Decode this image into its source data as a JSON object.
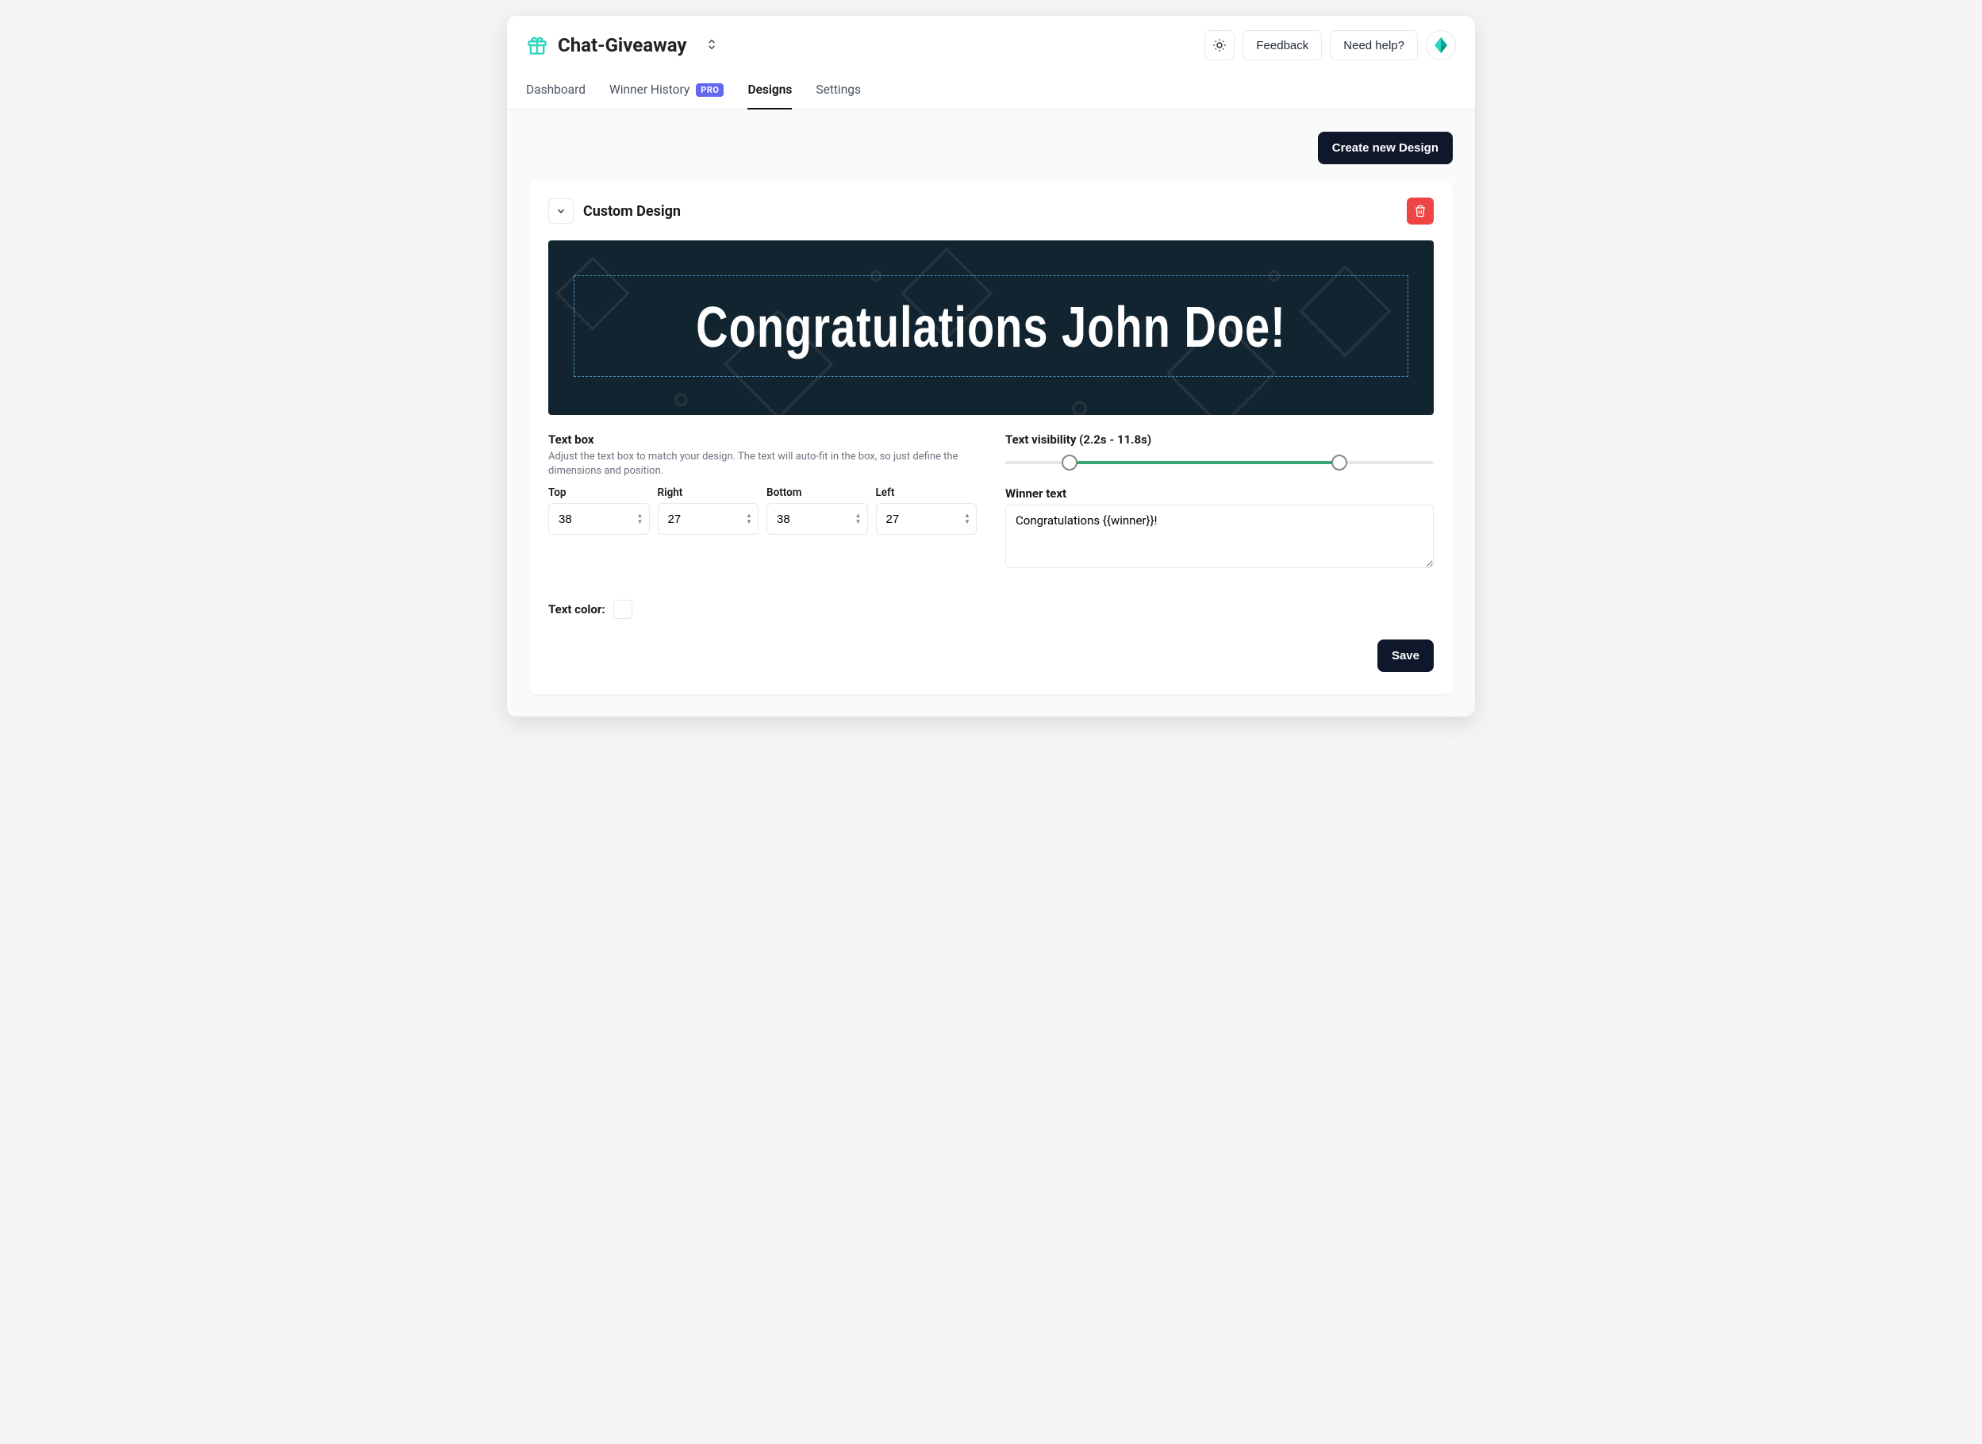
{
  "header": {
    "app_title": "Chat-Giveaway",
    "feedback_label": "Feedback",
    "help_label": "Need help?"
  },
  "tabs": {
    "dashboard": "Dashboard",
    "winner_history": "Winner History",
    "pro_badge": "PRO",
    "designs": "Designs",
    "settings": "Settings"
  },
  "actions": {
    "create_design": "Create new Design",
    "save": "Save"
  },
  "design": {
    "title": "Custom Design",
    "preview_text": "Congratulations John Doe!",
    "textbox": {
      "heading": "Text box",
      "description": "Adjust the text box to match your design. The text will auto-fit in the box, so just define the dimensions and position.",
      "top_label": "Top",
      "top_value": "38",
      "right_label": "Right",
      "right_value": "27",
      "bottom_label": "Bottom",
      "bottom_value": "38",
      "left_label": "Left",
      "left_value": "27"
    },
    "visibility": {
      "label": "Text visibility (2.2s - 11.8s)",
      "start_pct": 15,
      "end_pct": 78
    },
    "winner_text": {
      "label": "Winner text",
      "value": "Congratulations {{winner}}!"
    },
    "text_color": {
      "label": "Text color:",
      "value": "#ffffff"
    }
  }
}
